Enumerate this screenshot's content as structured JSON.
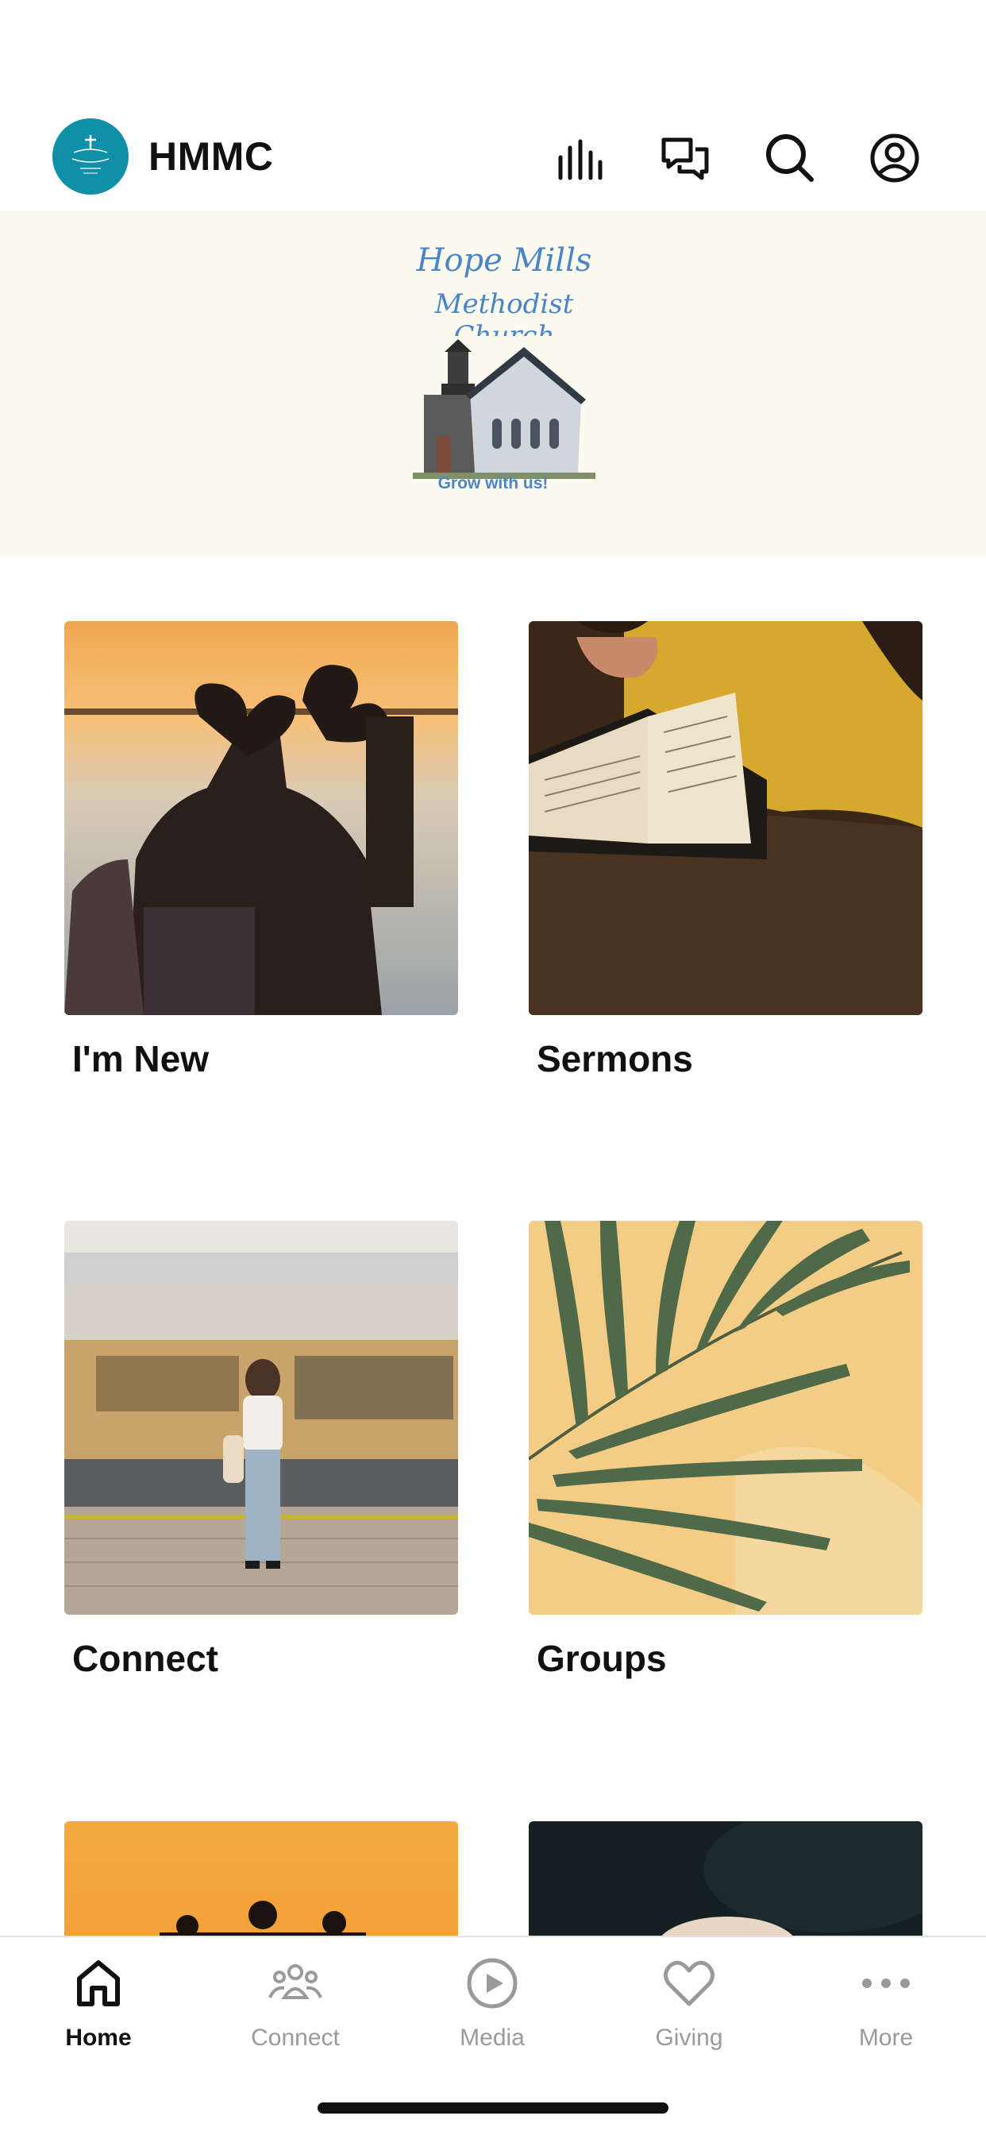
{
  "header": {
    "title": "HMMC",
    "icons": [
      "bars-chart-icon",
      "chat-bubbles-icon",
      "search-icon",
      "profile-icon"
    ]
  },
  "banner": {
    "script_line_1": "Hope Mills",
    "script_line_2": "Methodist Church",
    "tagline": "Grow with us!",
    "accent_color": "#4a86c5",
    "background": "#fcf9ef"
  },
  "tiles": [
    {
      "label": "I'm New",
      "image": "friends-heart-hands-sunset"
    },
    {
      "label": "Sermons",
      "image": "open-bible-on-table"
    },
    {
      "label": "Connect",
      "image": "woman-at-train-station"
    },
    {
      "label": "Groups",
      "image": "palm-leaf-on-yellow"
    },
    {
      "label": "",
      "image": "silhouettes-orange-sunset"
    },
    {
      "label": "",
      "image": "dark-coffee-cup"
    }
  ],
  "tabbar": {
    "tabs": [
      {
        "label": "Home",
        "icon": "home-icon",
        "active": true
      },
      {
        "label": "Connect",
        "icon": "people-icon",
        "active": false
      },
      {
        "label": "Media",
        "icon": "play-circle-icon",
        "active": false
      },
      {
        "label": "Giving",
        "icon": "heart-icon",
        "active": false
      },
      {
        "label": "More",
        "icon": "more-dots-icon",
        "active": false
      }
    ]
  },
  "colors": {
    "logo_circle": "#0f8fa8",
    "tab_inactive": "#9a9a9a",
    "tab_active": "#111111"
  }
}
